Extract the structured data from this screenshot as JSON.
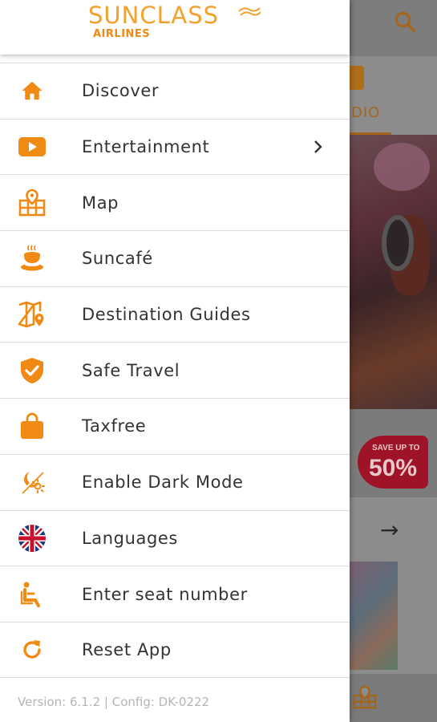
{
  "app": {
    "brand_name": "SUNCLASS",
    "brand_sub": "AIRLINES",
    "accent_color": "#f08a12"
  },
  "menu": {
    "items": [
      {
        "label": "Discover",
        "icon": "home-icon"
      },
      {
        "label": "Entertainment",
        "icon": "play-icon",
        "has_submenu": true
      },
      {
        "label": "Map",
        "icon": "map-pin-icon"
      },
      {
        "label": "Suncafé",
        "icon": "coffee-cup-icon"
      },
      {
        "label": "Destination Guides",
        "icon": "guide-map-icon"
      },
      {
        "label": "Safe Travel",
        "icon": "shield-check-icon"
      },
      {
        "label": "Taxfree",
        "icon": "shopping-bag-icon"
      },
      {
        "label": "Enable Dark Mode",
        "icon": "sun-moon-icon"
      },
      {
        "label": "Languages",
        "icon": "uk-flag-icon"
      },
      {
        "label": "Enter seat number",
        "icon": "seat-icon"
      },
      {
        "label": "Reset App",
        "icon": "refresh-icon"
      }
    ]
  },
  "footer": {
    "version_text": "Version: 6.1.2 | Config: DK-0222"
  },
  "background": {
    "tab_label": "DIO",
    "promo_small": "SAVE UP TO",
    "promo_big": "50%",
    "arrow": "→"
  }
}
